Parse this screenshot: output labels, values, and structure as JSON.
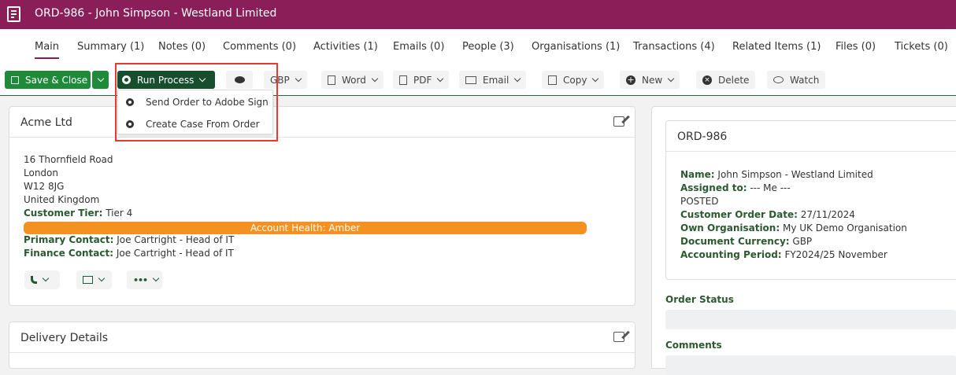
{
  "window": {
    "title": "ORD-986 - John Simpson - Westland Limited"
  },
  "tabs": [
    {
      "label": "Main"
    },
    {
      "label": "Summary (1)"
    },
    {
      "label": "Notes (0)"
    },
    {
      "label": "Comments (0)"
    },
    {
      "label": "Activities (1)"
    },
    {
      "label": "Emails (0)"
    },
    {
      "label": "People (3)"
    },
    {
      "label": "Organisations (1)"
    },
    {
      "label": "Transactions (4)"
    },
    {
      "label": "Related Items (1)"
    },
    {
      "label": "Files (0)"
    },
    {
      "label": "Tickets (0)"
    }
  ],
  "toolbar": {
    "save_label": "Save & Close",
    "run_label": "Run Process",
    "currency": "GBP",
    "word": "Word",
    "pdf": "PDF",
    "email": "Email",
    "copy": "Copy",
    "new": "New",
    "delete": "Delete",
    "watch": "Watch"
  },
  "run_menu": {
    "items": [
      {
        "label": "Send Order to Adobe Sign"
      },
      {
        "label": "Create Case From Order"
      }
    ]
  },
  "account_card": {
    "title": "Acme Ltd",
    "address": [
      "16 Thornfield Road",
      "London",
      "W12 8JG",
      "United Kingdom"
    ],
    "tier_label": "Customer Tier:",
    "tier_value": "Tier 4",
    "health": "Account Health: Amber",
    "primary_label": "Primary Contact:",
    "primary_value": "Joe Cartright - Head of IT",
    "finance_label": "Finance Contact:",
    "finance_value": "Joe Cartright - Head of IT"
  },
  "delivery_card": {
    "title": "Delivery Details"
  },
  "order_card": {
    "title": "ORD-986",
    "fields": [
      {
        "label": "Name:",
        "value": "John Simpson - Westland Limited"
      },
      {
        "label": "Assigned to:",
        "value": "--- Me ---"
      },
      {
        "label": "",
        "value": "POSTED"
      },
      {
        "label": "Customer Order Date:",
        "value": "27/11/2024"
      },
      {
        "label": "Own Organisation:",
        "value": "My UK Demo Organisation"
      },
      {
        "label": "Document Currency:",
        "value": "GBP"
      },
      {
        "label": "Accounting Period:",
        "value": "FY2024/25 November"
      }
    ]
  },
  "order_status": {
    "label": "Order Status"
  },
  "comments": {
    "label": "Comments"
  },
  "colors": {
    "brand": "#8a1e58",
    "save": "#1e8a3a",
    "run": "#164e2e",
    "amber": "#f39220",
    "label_green": "#2b5a2f"
  }
}
